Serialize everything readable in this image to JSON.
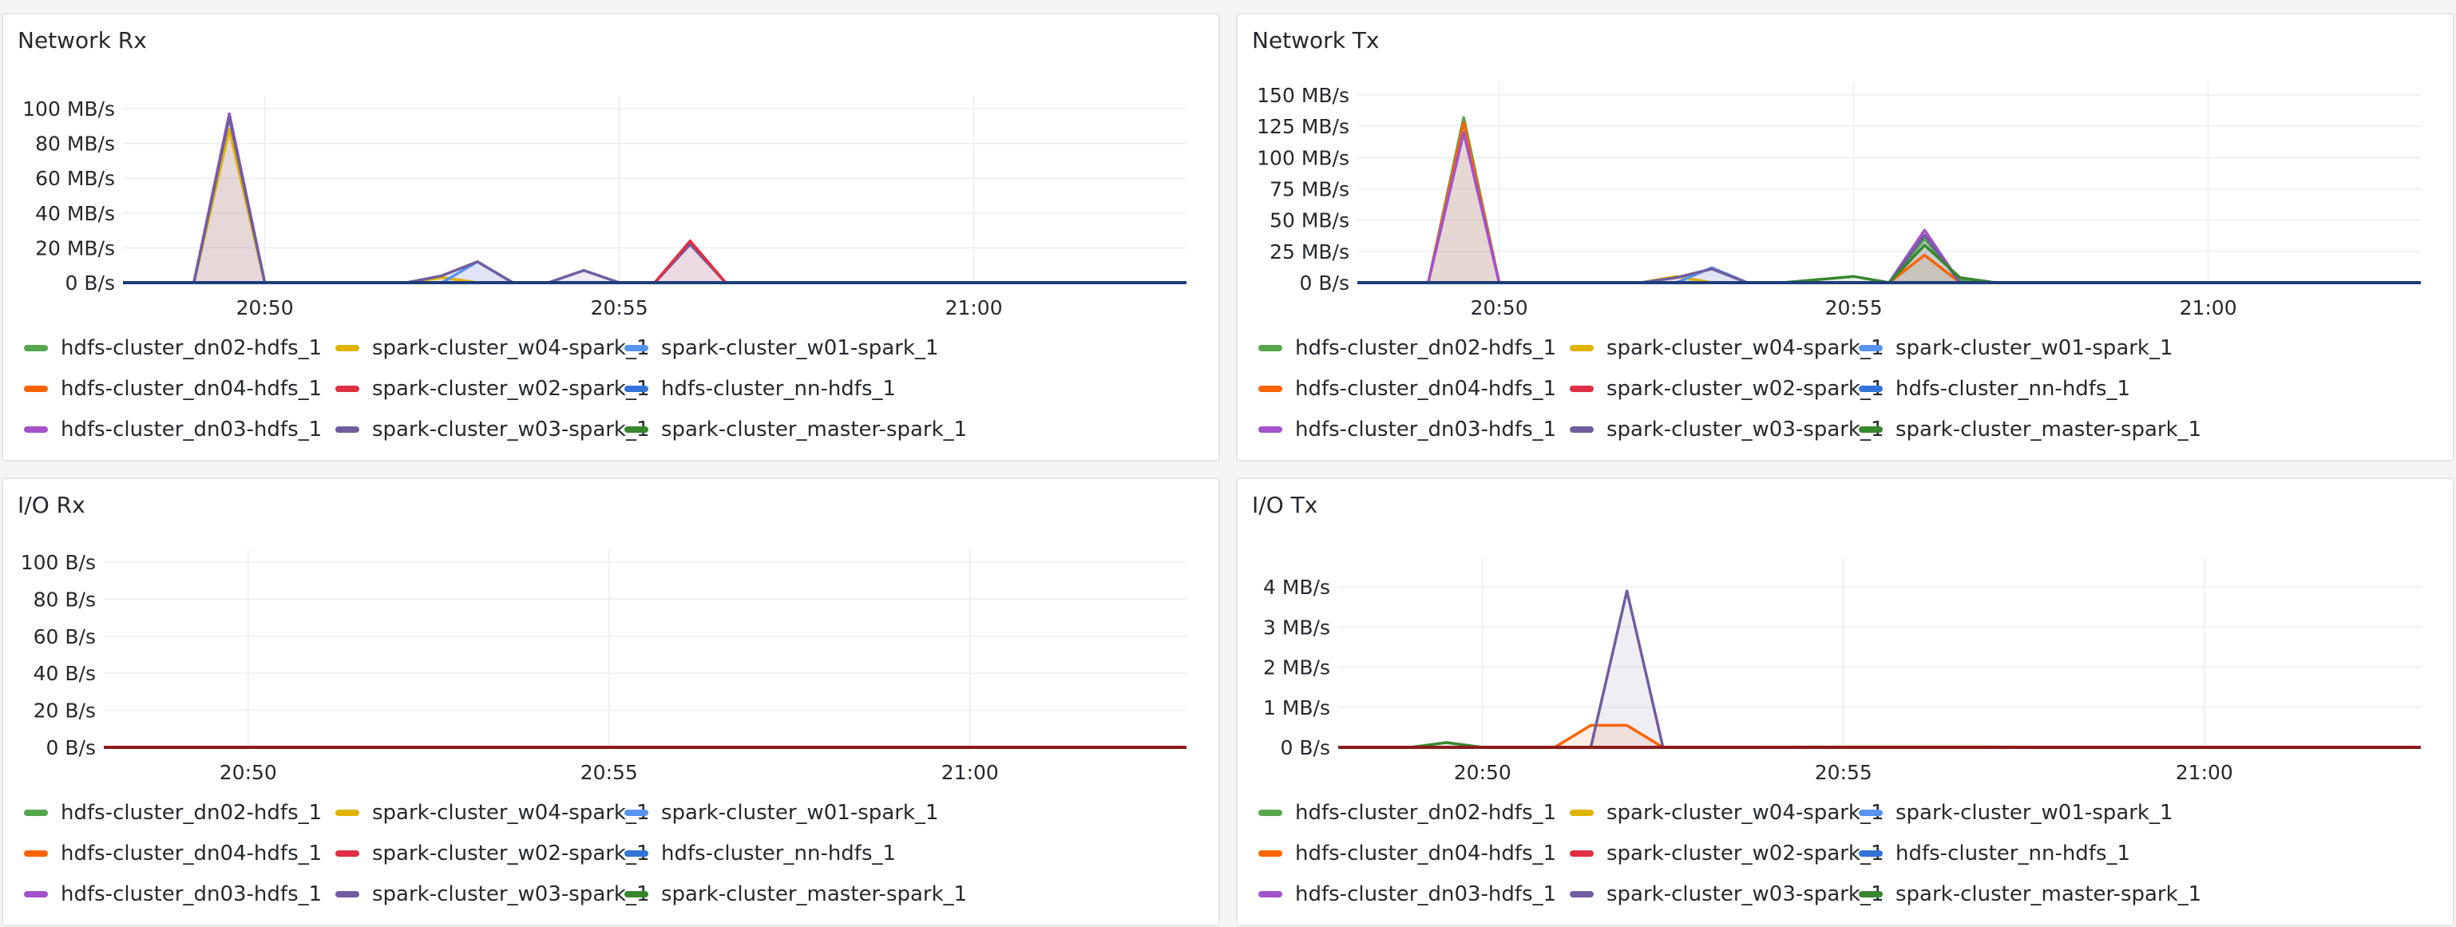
{
  "series": [
    {
      "name": "hdfs-cluster_dn02-hdfs_1",
      "color": "#56a64b"
    },
    {
      "name": "spark-cluster_w04-spark_1",
      "color": "#e0b400"
    },
    {
      "name": "spark-cluster_w01-spark_1",
      "color": "#5794f2"
    },
    {
      "name": "hdfs-cluster_dn04-hdfs_1",
      "color": "#fa6400"
    },
    {
      "name": "spark-cluster_w02-spark_1",
      "color": "#e02f44"
    },
    {
      "name": "hdfs-cluster_nn-hdfs_1",
      "color": "#3274d9"
    },
    {
      "name": "hdfs-cluster_dn03-hdfs_1",
      "color": "#a352cc"
    },
    {
      "name": "spark-cluster_w03-spark_1",
      "color": "#705da0"
    },
    {
      "name": "spark-cluster_master-spark_1",
      "color": "#37872d"
    }
  ],
  "chart_data": [
    {
      "type": "line",
      "title": "Network Rx",
      "unit": "MB/s",
      "x_range": [
        "20:48",
        "21:03"
      ],
      "x_ticks": [
        "20:50",
        "20:55",
        "21:00"
      ],
      "y_ticks": [
        "0 B/s",
        "20 MB/s",
        "40 MB/s",
        "60 MB/s",
        "80 MB/s",
        "100 MB/s"
      ],
      "ylim": [
        0,
        100
      ],
      "x": [
        "20:48",
        "20:49",
        "20:49:30",
        "20:50",
        "20:52",
        "20:52:30",
        "20:53",
        "20:53:30",
        "20:54",
        "20:54:30",
        "20:55",
        "20:55:30",
        "20:56",
        "20:56:30",
        "21:03"
      ],
      "series": [
        {
          "name": "hdfs-cluster_dn03-hdfs_1",
          "values": [
            0,
            0,
            97,
            0,
            0,
            0,
            0,
            0,
            0,
            0,
            0,
            0,
            0,
            0,
            0
          ]
        },
        {
          "name": "spark-cluster_w04-spark_1",
          "values": [
            0,
            0,
            88,
            0,
            0,
            3,
            0,
            0,
            0,
            0,
            0,
            0,
            0,
            0,
            0
          ]
        },
        {
          "name": "spark-cluster_w01-spark_1",
          "values": [
            0,
            0,
            0,
            0,
            0,
            0,
            12,
            0,
            0,
            0,
            0,
            0,
            0,
            0,
            0
          ]
        },
        {
          "name": "spark-cluster_w03-spark_1",
          "values": [
            0,
            0,
            95,
            0,
            0,
            4,
            12,
            0,
            0,
            7,
            0,
            0,
            22,
            0,
            0
          ]
        },
        {
          "name": "spark-cluster_w02-spark_1",
          "values": [
            0,
            0,
            0,
            0,
            0,
            0,
            0,
            0,
            0,
            0,
            0,
            0,
            24,
            0,
            0
          ]
        },
        {
          "name": "hdfs-cluster_nn-hdfs_1",
          "values": [
            0,
            0,
            0,
            0,
            0,
            0,
            0,
            0,
            0,
            0,
            0,
            0,
            0,
            0,
            0
          ]
        }
      ]
    },
    {
      "type": "line",
      "title": "Network Tx",
      "unit": "MB/s",
      "x_range": [
        "20:48",
        "21:03"
      ],
      "x_ticks": [
        "20:50",
        "20:55",
        "21:00"
      ],
      "y_ticks": [
        "0 B/s",
        "25 MB/s",
        "50 MB/s",
        "75 MB/s",
        "100 MB/s",
        "125 MB/s",
        "150 MB/s"
      ],
      "ylim": [
        0,
        150
      ],
      "x": [
        "20:48",
        "20:49",
        "20:49:30",
        "20:50",
        "20:52",
        "20:52:30",
        "20:53",
        "20:53:30",
        "20:54",
        "20:55",
        "20:55:30",
        "20:56",
        "20:56:30",
        "20:57",
        "21:03"
      ],
      "series": [
        {
          "name": "hdfs-cluster_dn02-hdfs_1",
          "values": [
            0,
            0,
            132,
            0,
            0,
            0,
            0,
            0,
            0,
            0,
            0,
            35,
            2,
            0,
            0
          ]
        },
        {
          "name": "hdfs-cluster_dn04-hdfs_1",
          "values": [
            0,
            0,
            128,
            0,
            0,
            0,
            0,
            0,
            0,
            0,
            0,
            22,
            0,
            0,
            0
          ]
        },
        {
          "name": "hdfs-cluster_dn03-hdfs_1",
          "values": [
            0,
            0,
            120,
            0,
            0,
            0,
            0,
            0,
            0,
            0,
            0,
            42,
            0,
            0,
            0
          ]
        },
        {
          "name": "spark-cluster_w04-spark_1",
          "values": [
            0,
            0,
            0,
            0,
            0,
            5,
            0,
            0,
            0,
            0,
            0,
            0,
            0,
            0,
            0
          ]
        },
        {
          "name": "spark-cluster_w01-spark_1",
          "values": [
            0,
            0,
            0,
            0,
            0,
            0,
            12,
            0,
            0,
            0,
            0,
            0,
            0,
            0,
            0
          ]
        },
        {
          "name": "spark-cluster_w03-spark_1",
          "values": [
            0,
            0,
            0,
            0,
            0,
            4,
            11,
            0,
            0,
            0,
            0,
            38,
            0,
            0,
            0
          ]
        },
        {
          "name": "spark-cluster_master-spark_1",
          "values": [
            0,
            0,
            0,
            0,
            0,
            0,
            0,
            0,
            0,
            5,
            0,
            30,
            4,
            0,
            0
          ]
        },
        {
          "name": "hdfs-cluster_nn-hdfs_1",
          "values": [
            0,
            0,
            0,
            0,
            0,
            0,
            0,
            0,
            0,
            0,
            0,
            0,
            0,
            0,
            0
          ]
        }
      ]
    },
    {
      "type": "line",
      "title": "I/O Rx",
      "unit": "B/s",
      "x_range": [
        "20:48",
        "21:03"
      ],
      "x_ticks": [
        "20:50",
        "20:55",
        "21:00"
      ],
      "y_ticks": [
        "0 B/s",
        "20 B/s",
        "40 B/s",
        "60 B/s",
        "80 B/s",
        "100 B/s"
      ],
      "ylim": [
        0,
        100
      ],
      "x": [
        "20:48",
        "21:03"
      ],
      "series": [
        {
          "name": "spark-cluster_w02-spark_1",
          "values": [
            0,
            0
          ]
        }
      ]
    },
    {
      "type": "line",
      "title": "I/O Tx",
      "unit": "MB/s",
      "x_range": [
        "20:48",
        "21:03"
      ],
      "x_ticks": [
        "20:50",
        "20:55",
        "21:00"
      ],
      "y_ticks": [
        "0 B/s",
        "1 MB/s",
        "2 MB/s",
        "3 MB/s",
        "4 MB/s"
      ],
      "ylim": [
        0,
        4.4
      ],
      "x": [
        "20:48",
        "20:49",
        "20:49:30",
        "20:50",
        "20:51",
        "20:51:30",
        "20:52",
        "20:52:30",
        "20:53",
        "20:55",
        "20:56",
        "20:57",
        "20:58",
        "21:03"
      ],
      "series": [
        {
          "name": "spark-cluster_master-spark_1",
          "values": [
            0,
            0,
            0.12,
            0,
            0,
            0,
            0,
            0,
            0,
            0,
            0,
            0,
            0,
            0
          ]
        },
        {
          "name": "hdfs-cluster_dn04-hdfs_1",
          "values": [
            0,
            0,
            0,
            0,
            0,
            0.55,
            0.55,
            0,
            0,
            0,
            0,
            0,
            0,
            0
          ]
        },
        {
          "name": "spark-cluster_w03-spark_1",
          "values": [
            0,
            0,
            0,
            0,
            0,
            0,
            3.9,
            0,
            0,
            0,
            0,
            0,
            0,
            0
          ]
        },
        {
          "name": "spark-cluster_w04-spark_1",
          "values": [
            0,
            0,
            0,
            0,
            0,
            0,
            0,
            0,
            0,
            0.01,
            0.01,
            0.01,
            0,
            0
          ]
        },
        {
          "name": "spark-cluster_w02-spark_1",
          "values": [
            0,
            0,
            0,
            0,
            0,
            0,
            0,
            0,
            0,
            0,
            0,
            0,
            0,
            0
          ]
        }
      ]
    }
  ]
}
